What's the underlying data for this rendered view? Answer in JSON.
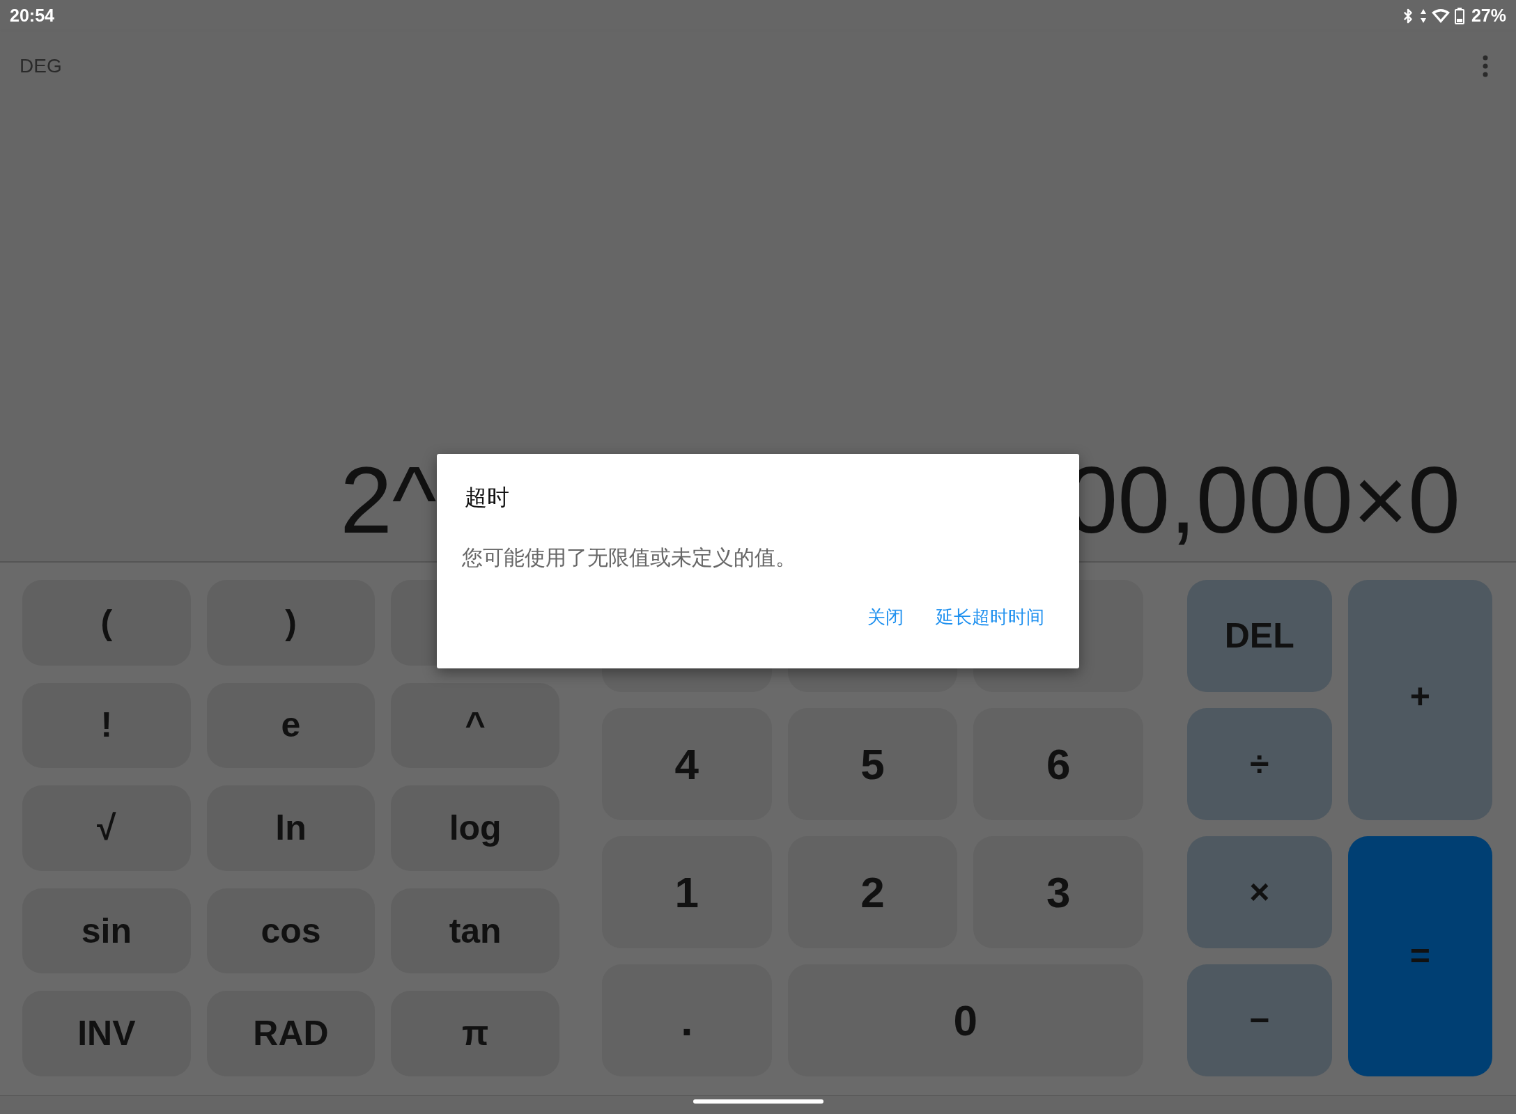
{
  "status_bar": {
    "time": "20:54",
    "battery": "27%"
  },
  "toolbar": {
    "angle_mode": "DEG"
  },
  "display": {
    "expression_left": "2^",
    "expression_right": "00,000×0"
  },
  "scientific_keys": [
    {
      "kind": "key",
      "label": "("
    },
    {
      "kind": "key",
      "label": ")"
    },
    {
      "kind": "blank"
    },
    {
      "kind": "key",
      "label": "!"
    },
    {
      "kind": "key",
      "label": "e"
    },
    {
      "kind": "key",
      "label": "^"
    },
    {
      "kind": "key",
      "label": "√"
    },
    {
      "kind": "key",
      "label": "ln"
    },
    {
      "kind": "key",
      "label": "log"
    },
    {
      "kind": "key",
      "label": "sin"
    },
    {
      "kind": "key",
      "label": "cos"
    },
    {
      "kind": "key",
      "label": "tan"
    },
    {
      "kind": "key",
      "label": "INV"
    },
    {
      "kind": "key",
      "label": "RAD"
    },
    {
      "kind": "key",
      "label": "π"
    }
  ],
  "number_keys": [
    {
      "kind": "blank"
    },
    {
      "kind": "blank"
    },
    {
      "kind": "blank"
    },
    {
      "kind": "key",
      "label": "4"
    },
    {
      "kind": "key",
      "label": "5"
    },
    {
      "kind": "key",
      "label": "6"
    },
    {
      "kind": "key",
      "label": "1"
    },
    {
      "kind": "key",
      "label": "2"
    },
    {
      "kind": "key",
      "label": "3"
    },
    {
      "kind": "key",
      "label": "."
    },
    {
      "kind": "wide",
      "label": "0"
    }
  ],
  "operator_keys": [
    {
      "kind": "op",
      "label": "DEL"
    },
    {
      "kind": "tall",
      "label": "+"
    },
    {
      "kind": "op",
      "label": "÷"
    },
    {
      "kind": "op",
      "label": "×"
    },
    {
      "kind": "equals",
      "label": "="
    },
    {
      "kind": "op",
      "label": "−"
    }
  ],
  "dialog": {
    "title": "超时",
    "message": "您可能使用了无限值或未定义的值。",
    "buttons": [
      "关闭",
      "延长超时时间"
    ]
  }
}
